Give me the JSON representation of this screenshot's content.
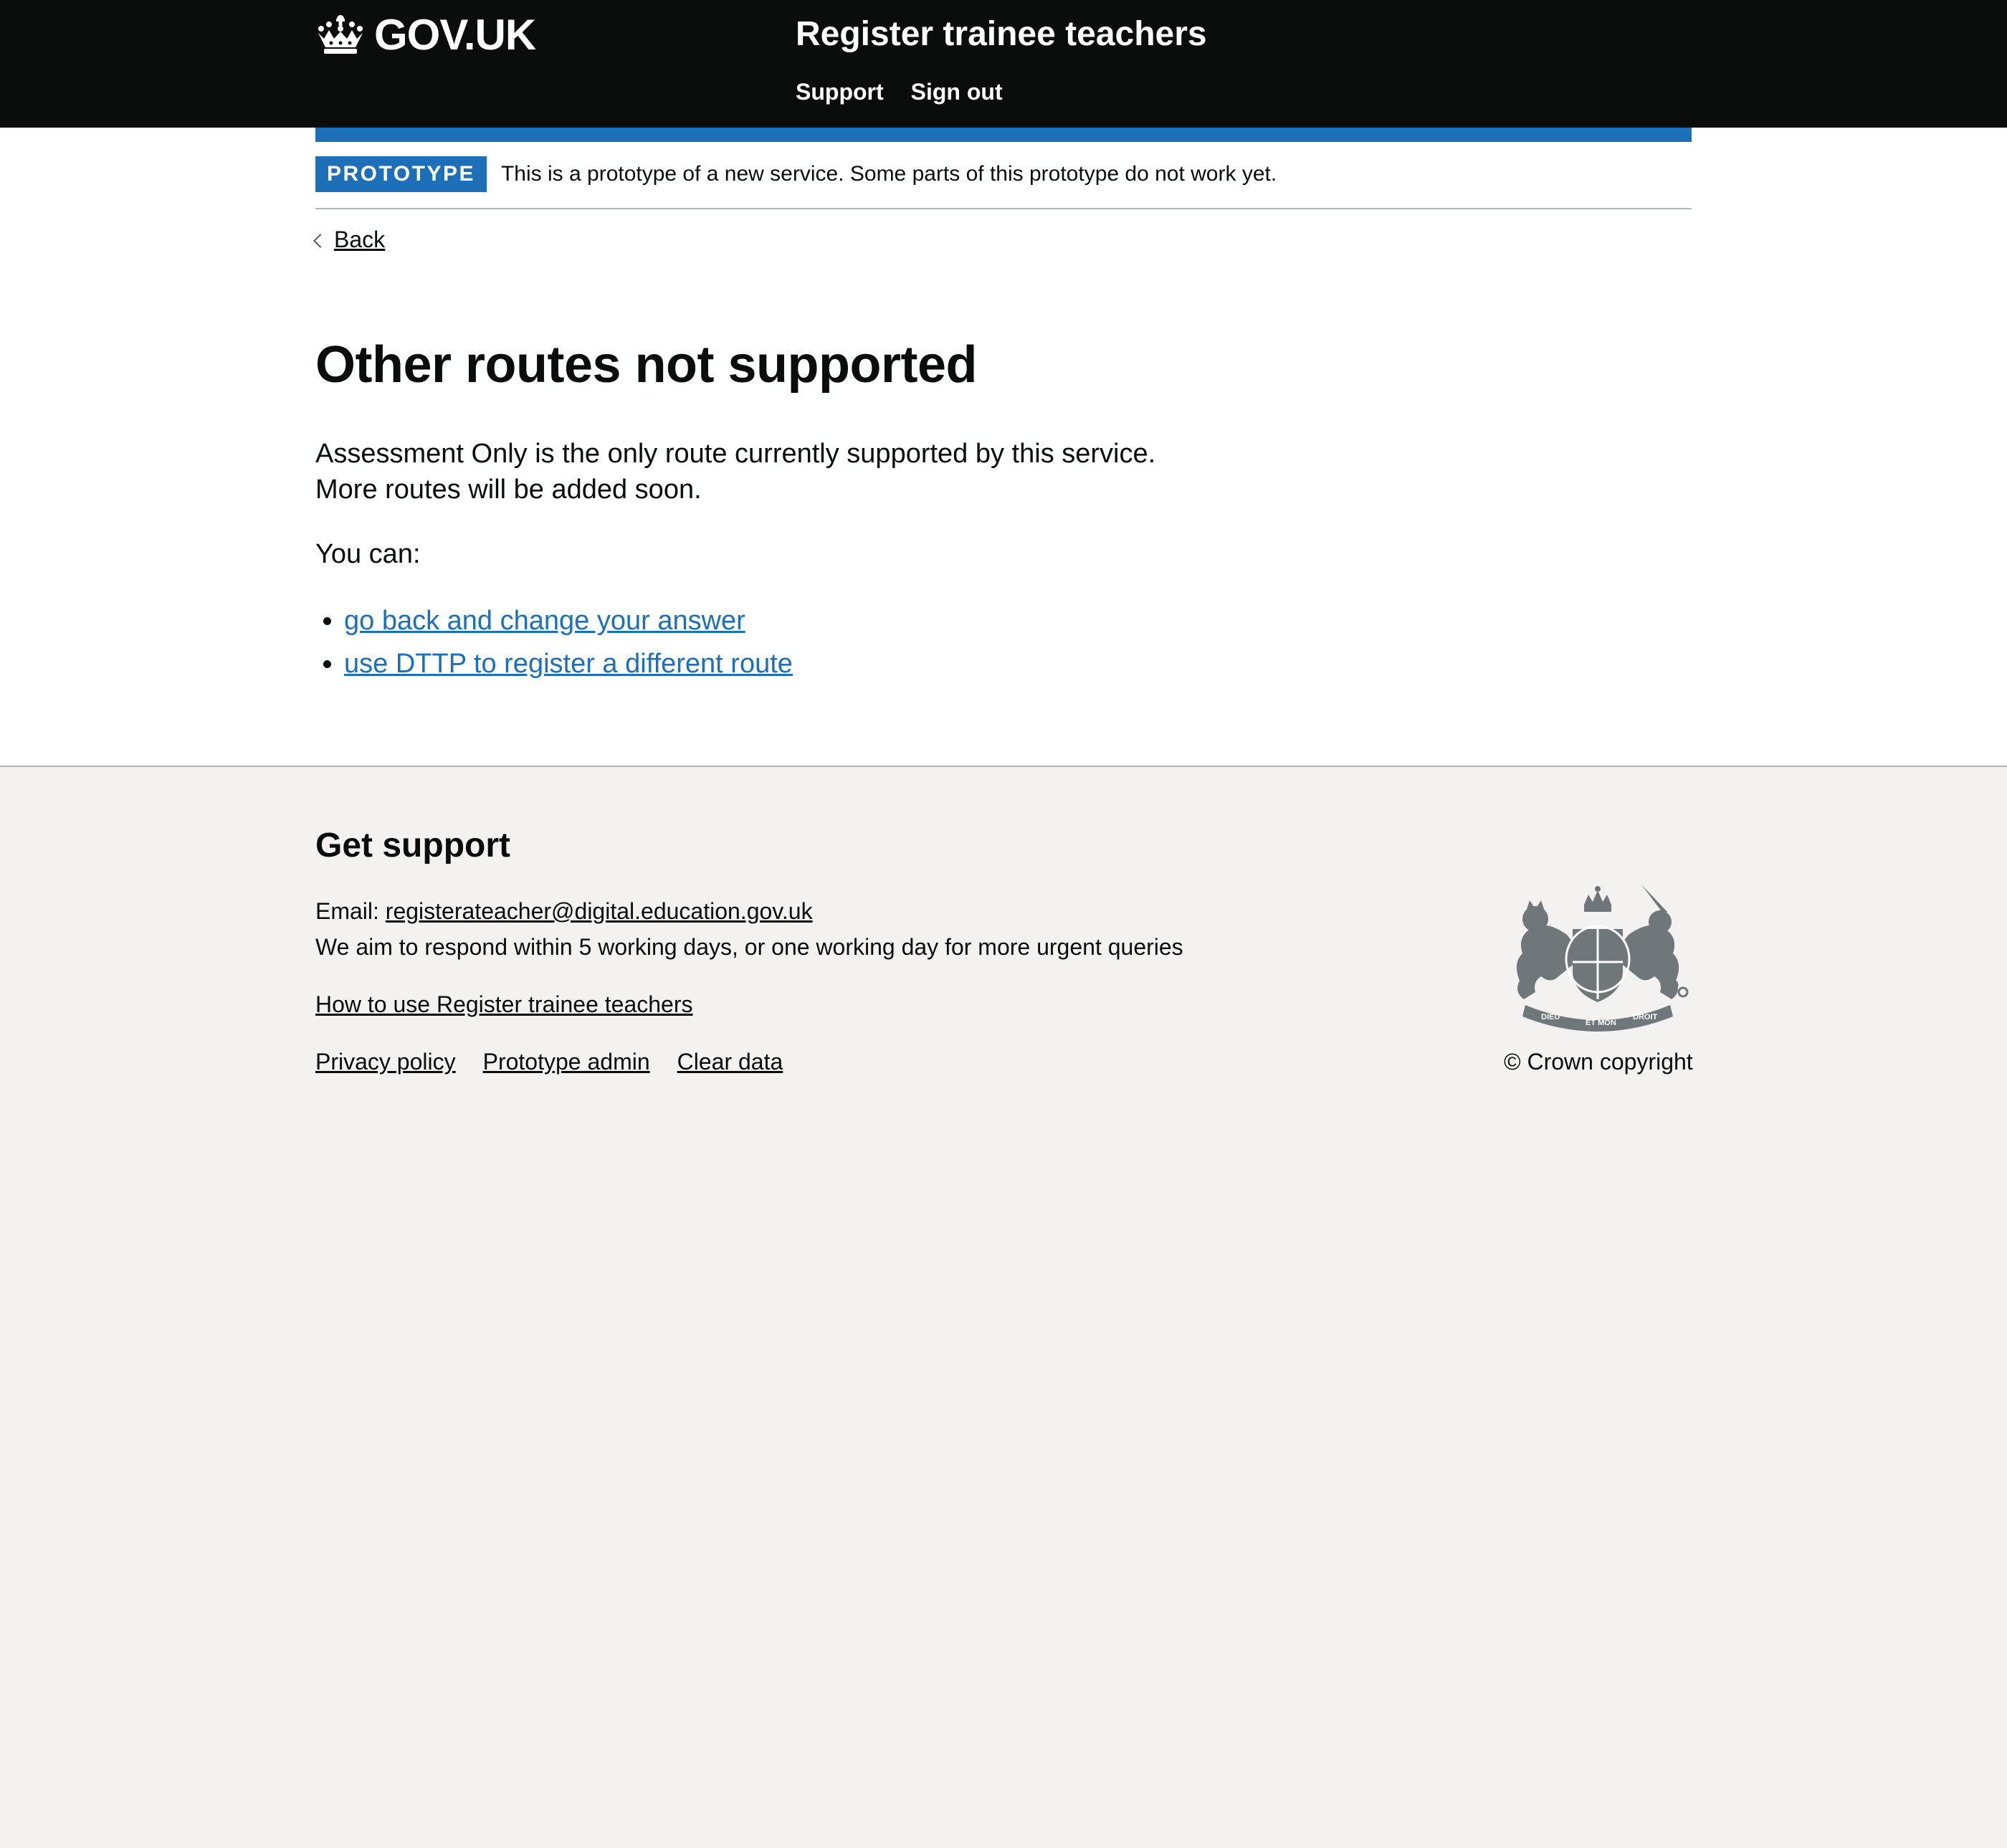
{
  "header": {
    "logo_text": "GOV.UK",
    "service_name": "Register trainee teachers",
    "nav": [
      {
        "label": "Support"
      },
      {
        "label": "Sign out"
      }
    ]
  },
  "phase_banner": {
    "tag": "PROTOTYPE",
    "text": "This is a prototype of a new service. Some parts of this prototype do not work yet."
  },
  "back_link": "Back",
  "main": {
    "title": "Other routes not supported",
    "lead": "Assessment Only is the only route currently supported by this service. More routes will be added soon.",
    "you_can": "You can:",
    "options": [
      {
        "label": "go back and change your answer"
      },
      {
        "label": "use DTTP to register a different route"
      }
    ]
  },
  "footer": {
    "heading": "Get support",
    "email_label": "Email:",
    "email": "registerateacher@digital.education.gov.uk",
    "response_note": "We aim to respond within 5 working days, or one working day for more urgent queries",
    "how_to_link": "How to use Register trainee teachers",
    "links": [
      {
        "label": "Privacy policy"
      },
      {
        "label": "Prototype admin"
      },
      {
        "label": "Clear data"
      }
    ],
    "crest_motto_1": "DIEU",
    "crest_motto_2": "ET MON",
    "crest_motto_3": "DROIT",
    "copyright": "© Crown copyright"
  },
  "colors": {
    "header_bg": "#0b0c0c",
    "brand_blue": "#1d70b8",
    "footer_bg": "#f3f2f1",
    "border_grey": "#b1b4b6",
    "crest_grey": "#6f777b"
  },
  "icons": [
    "crown-icon",
    "chevron-left-icon",
    "royal-coat-of-arms-icon"
  ]
}
